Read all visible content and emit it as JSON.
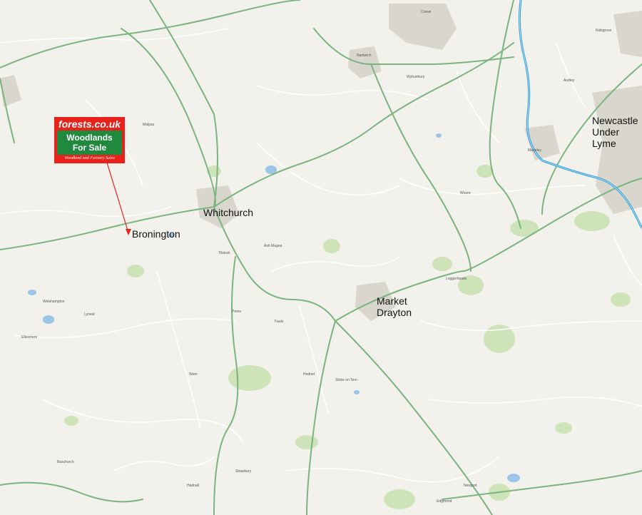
{
  "logo": {
    "brand": "forests.co.uk",
    "line1": "Woodlands",
    "line2": "For Sale",
    "tagline": "Woodland and Forestry Sales"
  },
  "towns": {
    "whitchurch": "Whitchurch",
    "bronington": "Bronington",
    "market_drayton": "Market\nDrayton",
    "newcastle": "Newcastle\nUnder\nLyme"
  },
  "places": [
    "Crewe",
    "Audley",
    "Kidsgrove",
    "Malpas",
    "Prees",
    "Hodnet",
    "Wem",
    "Ellesmere",
    "Loggerheads",
    "Baschurch",
    "Shawbury",
    "Ash Magna",
    "Stoke on Tern",
    "Woore",
    "Madeley",
    "Wybunbury",
    "Nantwich",
    "Tilstock",
    "Fauls",
    "Lyneal",
    "Welshampton",
    "Hadnall",
    "Edgmond",
    "Newport"
  ],
  "colors": {
    "land": "#f2f1ec",
    "road_main": "#7ab47f",
    "road_minor": "#ffffff",
    "motorway": "#3ba3dd",
    "woodland": "#cfe3b8",
    "water": "#9cc4e6",
    "urban": "#d9d6cd",
    "pointer": "#e8211b"
  }
}
